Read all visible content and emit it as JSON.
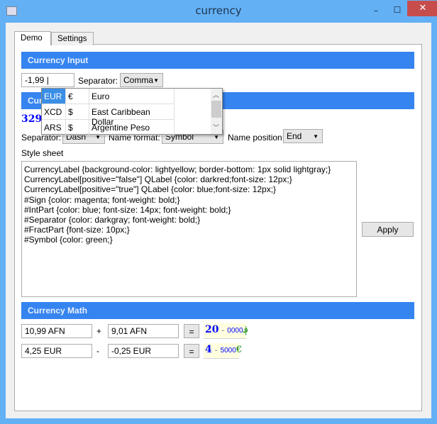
{
  "window": {
    "title": "currency",
    "minimize": "–",
    "maximize": "☐",
    "close": "✕"
  },
  "tabs": [
    {
      "label": "Demo",
      "active": true
    },
    {
      "label": "Settings",
      "active": false
    }
  ],
  "currency_input": {
    "header": "Currency Input",
    "value": "-1,99",
    "separator_label": "Separator:",
    "separator_value": "Comma",
    "popup": [
      {
        "code": "EUR",
        "symbol": "€",
        "name": "Euro",
        "selected": true
      },
      {
        "code": "XCD",
        "symbol": "$",
        "name": "East Caribbean Dollar"
      },
      {
        "code": "ARS",
        "symbol": "$",
        "name": "Argentine Peso"
      }
    ]
  },
  "currency_label": {
    "header": "Currency Label",
    "value": "329",
    "separator_label": "Separator:",
    "separator_value": "Dash",
    "name_format_label": "Name format:",
    "name_format_value": "Symbol",
    "name_position_label": "Name position:",
    "name_position_value": "End",
    "stylesheet_label": "Style sheet",
    "stylesheet": "CurrencyLabel {background-color: lightyellow; border-bottom: 1px solid lightgray;}\nCurrencyLabel[positive=\"false\"] QLabel {color: darkred;font-size: 12px;}\nCurrencyLabel[positive=\"true\"] QLabel {color: blue;font-size: 12px;}\n#Sign {color: magenta; font-weight: bold;}\n#IntPart {color: blue; font-size: 14px; font-weight: bold;}\n#Separator {color: darkgray; font-weight: bold;}\n#FractPart {font-size: 10px;}\n#Symbol {color: green;}",
    "apply": "Apply"
  },
  "currency_math": {
    "header": "Currency Math",
    "rows": [
      {
        "a": "10,99 AFN",
        "op": "+",
        "b": "9,01 AFN",
        "eq": "=",
        "int": "20",
        "sep": "-",
        "fract": "0000",
        "symbol": "؋"
      },
      {
        "a": "4,25 EUR",
        "op": "-",
        "b": "-0,25 EUR",
        "eq": "=",
        "int": "4",
        "sep": "-",
        "fract": "5000",
        "symbol": "€"
      }
    ]
  },
  "colors": {
    "header": "#3584f0",
    "title_bar": "#64b0f4",
    "close": "#c74d4d"
  }
}
